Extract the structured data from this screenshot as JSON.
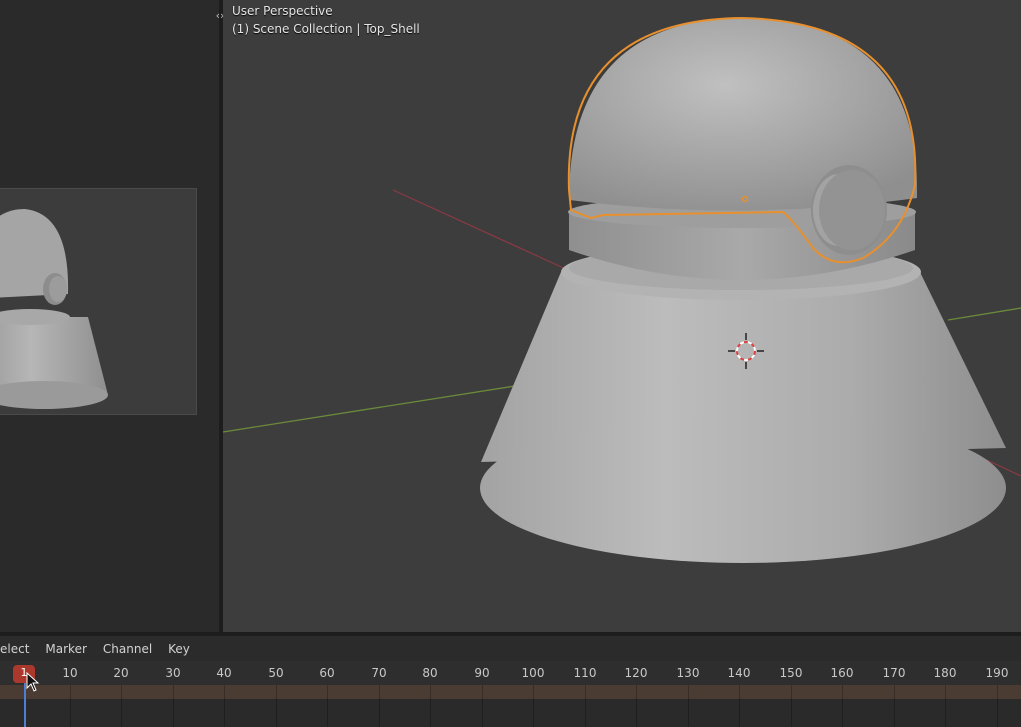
{
  "viewport": {
    "view_label": "User Perspective",
    "collection_label": "(1) Scene Collection | Top_Shell",
    "collapse_icon": "chevron-left-right-icon"
  },
  "timeline": {
    "menu": [
      "elect",
      "Marker",
      "Channel",
      "Key"
    ],
    "current_frame": "1",
    "ticks": [
      "10",
      "20",
      "30",
      "40",
      "50",
      "60",
      "70",
      "80",
      "90",
      "100",
      "110",
      "120",
      "130",
      "140",
      "150",
      "160",
      "170",
      "180",
      "190"
    ]
  },
  "colors": {
    "selection_outline": "#e8902e",
    "playhead": "#c0392b",
    "viewport_bg": "#3d3d3d"
  }
}
